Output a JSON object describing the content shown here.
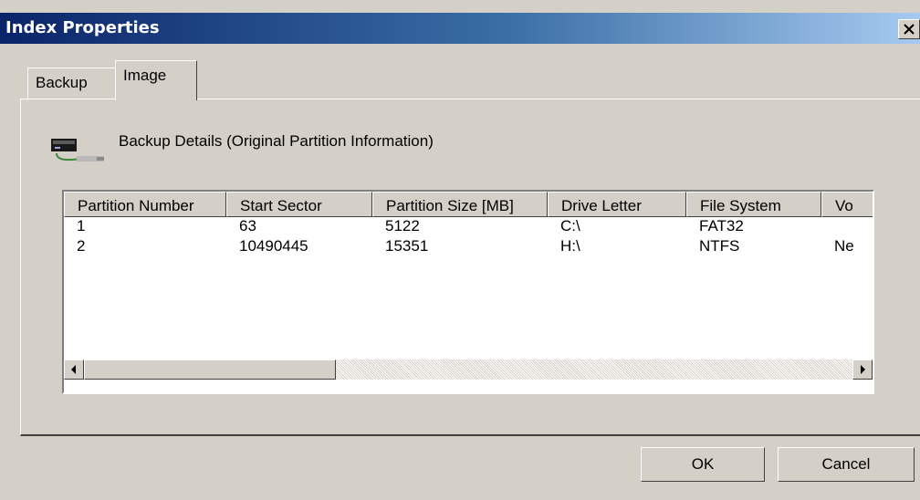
{
  "window": {
    "title": "Index Properties",
    "close_icon": "close-icon"
  },
  "tabs": [
    {
      "label": "Backup",
      "selected": false
    },
    {
      "label": "Image",
      "selected": true
    }
  ],
  "details": {
    "icon": "hard-disk-icon",
    "label": "Backup Details (Original Partition Information)"
  },
  "table": {
    "columns": [
      "Partition Number",
      "Start Sector",
      "Partition Size [MB]",
      "Drive Letter",
      "File System",
      "Vo"
    ],
    "rows": [
      [
        "1",
        "63",
        "5122",
        "C:\\",
        "FAT32",
        ""
      ],
      [
        "2",
        "10490445",
        "15351",
        "H:\\",
        "NTFS",
        "Ne"
      ]
    ]
  },
  "buttons": {
    "ok": "OK",
    "cancel": "Cancel"
  }
}
